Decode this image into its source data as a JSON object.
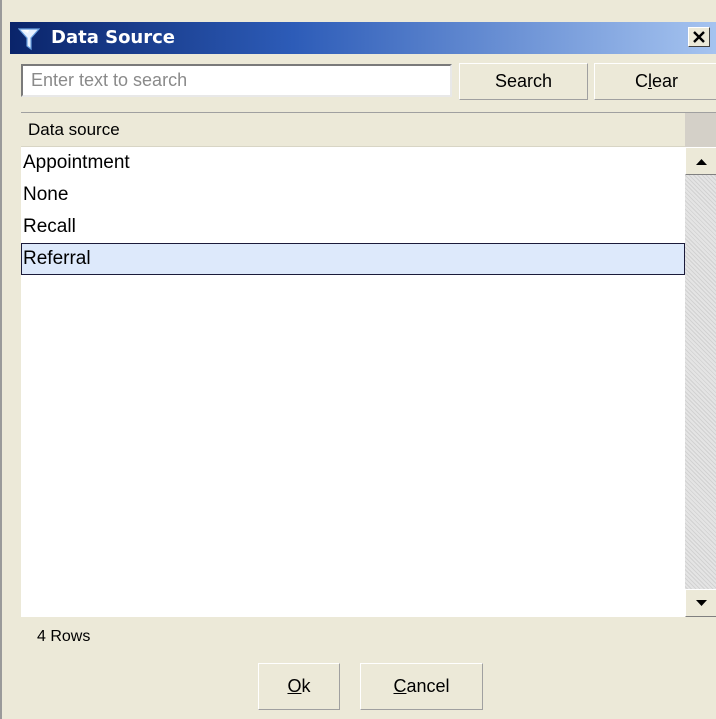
{
  "window": {
    "title": "Data Source",
    "title_icon": "funnel-icon",
    "close_label": "close-icon"
  },
  "search": {
    "placeholder": "Enter text to search",
    "value": "",
    "search_label": "Search",
    "clear_label_pre": "C",
    "clear_label_mnemonic": "l",
    "clear_label_post": "ear"
  },
  "list": {
    "column_header": "Data source",
    "rows": [
      "Appointment",
      "None",
      "Recall",
      "Referral"
    ],
    "selected_row": "Referral"
  },
  "status": {
    "rows_count": "4 Rows"
  },
  "footer": {
    "ok_mnemonic": "O",
    "ok_rest": "k",
    "cancel_mnemonic": "C",
    "cancel_rest": "ancel"
  }
}
